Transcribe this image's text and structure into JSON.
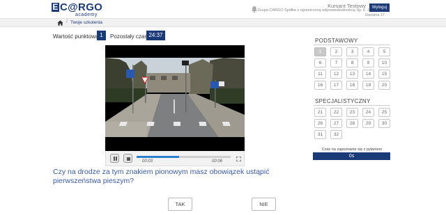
{
  "header": {
    "logo_main": "C@RGO",
    "logo_e": "E",
    "logo_sub": "academy",
    "user_name": "Kursant Testowy",
    "user_company": "Grupa CARGO Spółka z ograniczoną odpowiedzialnością Sp. k. Jaworzno, Darwina 17",
    "logout_label": "Wyloguj"
  },
  "breadcrumb": {
    "separator": "/",
    "item": "Twoje szkolenia"
  },
  "stats": {
    "points_label": "Wartość punktowa",
    "points_value": "1",
    "time_label": "Pozostały czas",
    "time_value": "24:37"
  },
  "player": {
    "current_time": "00:03",
    "total_time": "00:06",
    "progress": 0.45
  },
  "question": {
    "text": "Czy na drodze za tym znakiem pionowym masz obowiązek ustąpić pierwszeństwa pieszym?"
  },
  "answers": {
    "yes": "TAK",
    "no": "NIE"
  },
  "panel": {
    "basic_title": "PODSTAWOWY",
    "basic_items": [
      "1",
      "2",
      "3",
      "4",
      "5",
      "6",
      "7",
      "8",
      "9",
      "10",
      "11",
      "12",
      "13",
      "14",
      "15",
      "16",
      "17",
      "18",
      "19",
      "20"
    ],
    "active_item": "1",
    "specialist_title": "SPECJALISTYCZNY",
    "specialist_items": [
      "21",
      "22",
      "23",
      "24",
      "25",
      "26",
      "27",
      "28",
      "29",
      "30",
      "31",
      "32"
    ],
    "timer_label": "Czas na zapoznanie się z pytaniem",
    "timer_value": "0s"
  },
  "colors": {
    "brand": "#1b3a78",
    "question_text": "#3a5aa0",
    "progress": "#2a7fcf"
  },
  "icons": [
    "bell-icon",
    "home-icon",
    "pause-icon",
    "stop-icon",
    "fullscreen-icon"
  ]
}
